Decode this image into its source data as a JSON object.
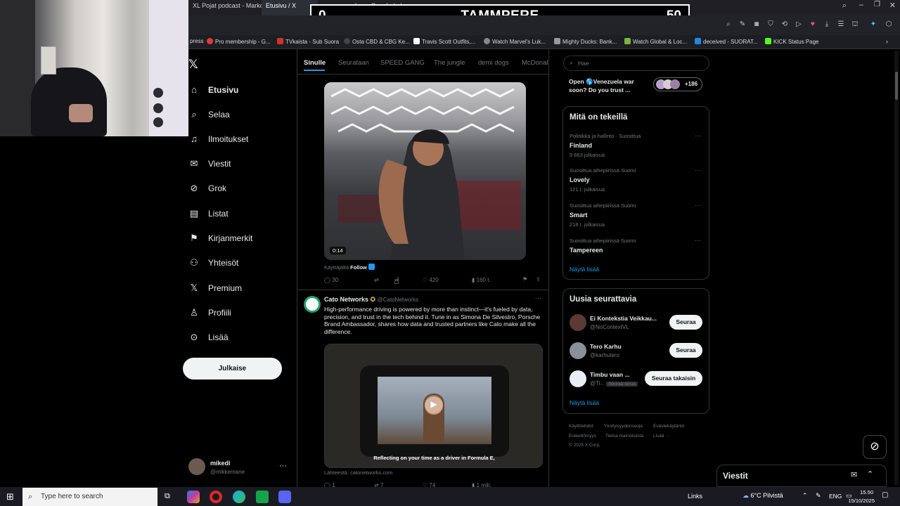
{
  "score": {
    "left": "0",
    "team": "TAMMPERE",
    "right": "50"
  },
  "tabs": [
    {
      "label": "XL Pojat podcast - Marko"
    },
    {
      "label": "Etusivu / X"
    },
    {
      "label": "quebec - Google-haku"
    }
  ],
  "bookmarks": [
    {
      "label": "press",
      "color": "#3b5998"
    },
    {
      "label": "Pro membership - G...",
      "color": "#e53935"
    },
    {
      "label": "TVkaista - Sub Suora",
      "color": "#d32f2f"
    },
    {
      "label": "Osta CBD & CBG Ke...",
      "color": "#444"
    },
    {
      "label": "Travis Scott Outfits,...",
      "color": "#fff"
    },
    {
      "label": "Watch Marvel's Luk...",
      "color": "#888"
    },
    {
      "label": "Mighty Ducks: Bank...",
      "color": "#999"
    },
    {
      "label": "Watch Global & Loc...",
      "color": "#7cb342"
    },
    {
      "label": "deceived - SUORAT...",
      "color": "#1e88e5"
    },
    {
      "label": "KICK Status Page",
      "color": "#53fc18"
    }
  ],
  "nav": [
    {
      "label": "Etusivu",
      "icon": "home-icon"
    },
    {
      "label": "Selaa",
      "icon": "search-icon"
    },
    {
      "label": "Ilmoitukset",
      "icon": "bell-icon"
    },
    {
      "label": "Viestit",
      "icon": "mail-icon"
    },
    {
      "label": "Grok",
      "icon": "grok-icon"
    },
    {
      "label": "Listat",
      "icon": "list-icon"
    },
    {
      "label": "Kirjanmerkit",
      "icon": "bookmark-icon"
    },
    {
      "label": "Yhteisöt",
      "icon": "people-icon"
    },
    {
      "label": "Premium",
      "icon": "x-logo-icon"
    },
    {
      "label": "Profiili",
      "icon": "person-icon"
    },
    {
      "label": "Lisää",
      "icon": "more-circle-icon"
    }
  ],
  "post_button": "Julkaise",
  "account": {
    "name": "mikedi",
    "handle": "@mikkemane"
  },
  "feed_tabs": [
    "Sinulle",
    "Seurataan",
    "SPEED GANG",
    "The jungle",
    "demi dogs",
    "McDonal"
  ],
  "tweet1": {
    "video_time": "0:14",
    "used_by": "Käyttäjältä",
    "follow": "Follow",
    "replies": "30",
    "likes": "420",
    "views": "160 t."
  },
  "tweet2": {
    "name": "Cato Networks",
    "handle": "@CatoNetworks",
    "text": "High-performance driving is powered by more than instinct—it's fueled by data, precision, and trust in the tech behind it. Tune in as Simona De Silvestro, Porsche Brand Ambassador, shares how data and trusted partners like Cato make all the difference.",
    "caption": "Reflecting on your time as a driver in Formula E,",
    "source": "Lähteestä: catonetworks.com",
    "replies": "1",
    "reposts": "7",
    "likes": "74",
    "views": "1 milj."
  },
  "search_placeholder": "Hae",
  "promo": {
    "text": "Open 🌎Venezuela war soon? Do you trust ...",
    "count": "+186"
  },
  "trends": {
    "title": "Mitä on tekeillä",
    "items": [
      {
        "context": "Politiikka ja hallinto · Suosittua",
        "name": "Finland",
        "count": "9 663 julkaisua"
      },
      {
        "context": "Suosittua aihepiirissä Suomi",
        "name": "Lovely",
        "count": "121 t. julkaisua"
      },
      {
        "context": "Suosittua aihepiirissä Suomi",
        "name": "Smart",
        "count": "218 t. julkaisua"
      },
      {
        "context": "Suosittua aihepiirissä Suomi",
        "name": "Tampereen",
        "count": ""
      }
    ],
    "show_more": "Näytä lisää"
  },
  "who_to_follow": {
    "title": "Uusia seurattavia",
    "items": [
      {
        "name": "Ei Kontekstia Veikkau...",
        "handle": "@NoContextVL",
        "button": "Seuraa"
      },
      {
        "name": "Tero Karhu",
        "handle": "@karhutero",
        "button": "Seuraa"
      },
      {
        "name": "Timbu vaan ...",
        "handle": "@Ti...",
        "badge": "Seuraa sinua",
        "button": "Seuraa takaisin"
      }
    ],
    "show_more": "Näytä lisää"
  },
  "footer": [
    "Käyttöehdot",
    "Yksityisyydensuoja",
    "Evästekäytäntö",
    "Esteettömyys",
    "Tietoa mainoksista",
    "Lisää ···",
    "© 2025 X Corp."
  ],
  "messages_label": "Viestit",
  "taskbar": {
    "search_placeholder": "Type here to search",
    "links": "Links",
    "weather": "6°C Pilvistä",
    "lang": "ENG",
    "time": "15.50",
    "date": "15/10/2025"
  }
}
